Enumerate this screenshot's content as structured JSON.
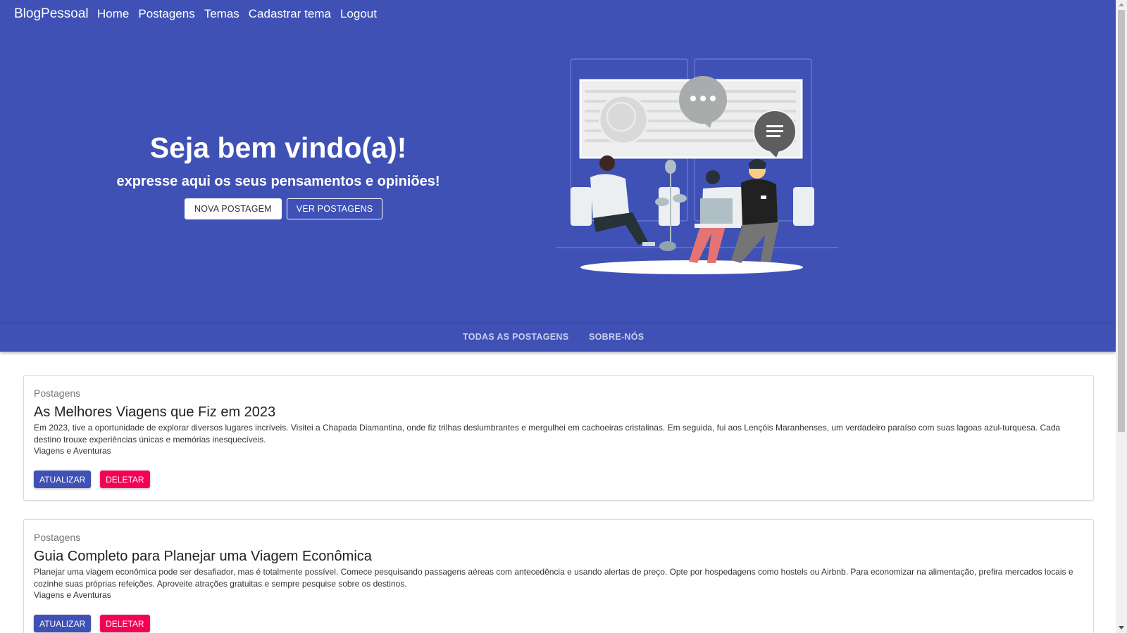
{
  "navbar": {
    "brand": "BlogPessoal",
    "links": [
      "Home",
      "Postagens",
      "Temas",
      "Cadastrar tema",
      "Logout"
    ]
  },
  "hero": {
    "title": "Seja bem vindo(a)!",
    "subtitle": "expresse aqui os seus pensamentos e opiniões!",
    "new_post_label": "NOVA POSTAGEM",
    "view_posts_label": "VER POSTAGENS",
    "illustration": "people-meeting-illustration"
  },
  "tabs": [
    "TODAS AS POSTAGENS",
    "SOBRE-NÓS"
  ],
  "posts": [
    {
      "overline": "Postagens",
      "title": "As Melhores Viagens que Fiz em 2023",
      "text": "Em 2023, tive a oportunidade de explorar diversos lugares incríveis. Visitei a Chapada Diamantina, onde fiz trilhas deslumbrantes e mergulhei em cachoeiras cristalinas. Em seguida, fui aos Lençóis Maranhenses, um verdadeiro paraíso com suas lagoas azul-turquesa. Cada destino trouxe experiências únicas e memórias inesquecíveis.",
      "tema": "Viagens e Aventuras",
      "update_label": "ATUALIZAR",
      "delete_label": "DELETAR"
    },
    {
      "overline": "Postagens",
      "title": "Guia Completo para Planejar uma Viagem Econômica",
      "text": "Planejar uma viagem econômica pode ser desafiador, mas é totalmente possível. Comece pesquisando passagens aéreas com antecedência e usando alertas de preço. Opte por hospedagens como hostels ou Airbnb. Para economizar na alimentação, prefira mercados locais e cozinhe suas próprias refeições. Aproveite atrações gratuitas e sempre pesquise sobre os destinos.",
      "tema": "Viagens e Aventuras",
      "update_label": "ATUALIZAR",
      "delete_label": "DELETAR"
    }
  ],
  "colors": {
    "primary": "#3f51b5",
    "secondary": "#f50057",
    "text": "#212121"
  }
}
